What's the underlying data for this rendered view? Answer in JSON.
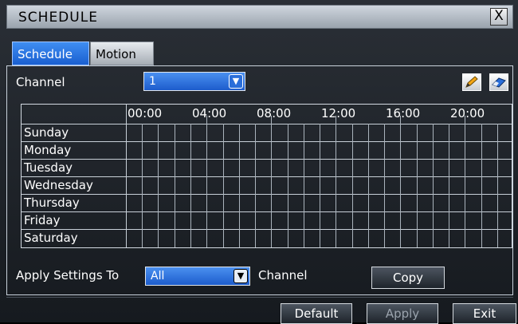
{
  "window": {
    "title": "SCHEDULE",
    "close_label": "X"
  },
  "tabs": [
    {
      "label": "Schedule"
    },
    {
      "label": "Motion"
    }
  ],
  "channel": {
    "label": "Channel",
    "value": "1"
  },
  "tools": {
    "edit_icon": "pencil-icon",
    "erase_icon": "eraser-icon"
  },
  "schedule": {
    "hours": [
      "00:00",
      "04:00",
      "08:00",
      "12:00",
      "16:00",
      "20:00"
    ],
    "days": [
      "Sunday",
      "Monday",
      "Tuesday",
      "Wednesday",
      "Thursday",
      "Friday",
      "Saturday"
    ]
  },
  "apply": {
    "label": "Apply Settings To",
    "value": "All",
    "suffix": "Channel",
    "copy_label": "Copy"
  },
  "footer": {
    "default_label": "Default",
    "apply_label": "Apply",
    "exit_label": "Exit"
  }
}
